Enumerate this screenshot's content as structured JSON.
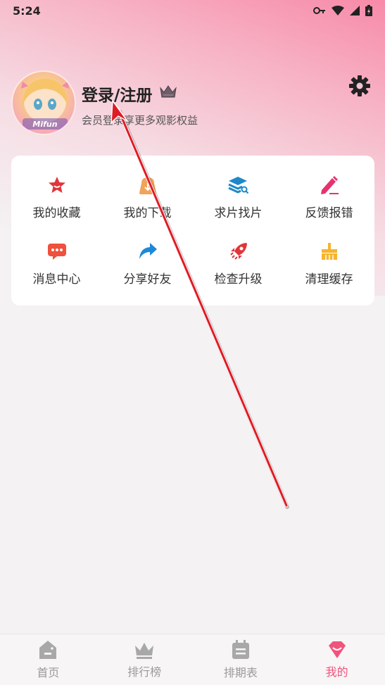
{
  "status_bar": {
    "time": "5:24"
  },
  "profile": {
    "login_label": "登录/注册",
    "subtitle": "会员登录享更多观影权益",
    "avatar_logo": "Mifun"
  },
  "grid": {
    "items": [
      {
        "label": "我的收藏",
        "icon": "star-icon",
        "color": "#e0353a"
      },
      {
        "label": "我的下载",
        "icon": "download-bag-icon",
        "color": "#f0a35a"
      },
      {
        "label": "求片找片",
        "icon": "layers-search-icon",
        "color": "#1e88c8"
      },
      {
        "label": "反馈报错",
        "icon": "pencil-icon",
        "color": "#e6336f"
      },
      {
        "label": "消息中心",
        "icon": "message-icon",
        "color": "#f0503c"
      },
      {
        "label": "分享好友",
        "icon": "share-arrow-icon",
        "color": "#1e88d8"
      },
      {
        "label": "检查升级",
        "icon": "rocket-icon",
        "color": "#e0353a"
      },
      {
        "label": "清理缓存",
        "icon": "broom-icon",
        "color": "#f5b52e"
      }
    ]
  },
  "tabbar": {
    "tabs": [
      {
        "label": "首页",
        "icon": "home-icon",
        "active": false
      },
      {
        "label": "排行榜",
        "icon": "crown-icon",
        "active": false
      },
      {
        "label": "排期表",
        "icon": "calendar-icon",
        "active": false
      },
      {
        "label": "我的",
        "icon": "diamond-heart-icon",
        "active": true
      }
    ],
    "active_color": "#f0537c",
    "inactive_color": "#9b9b9b"
  }
}
